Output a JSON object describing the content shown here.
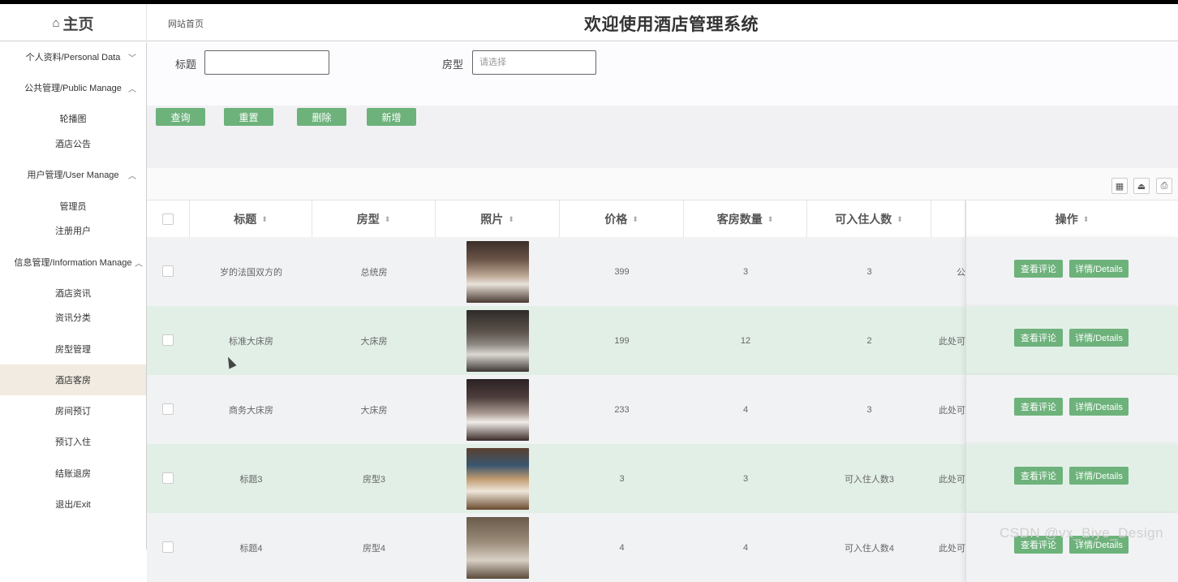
{
  "header": {
    "home_icon": "home-icon",
    "home_label": "主页",
    "breadcrumb": "网站首页",
    "title": "欢迎使用酒店管理系统"
  },
  "sidebar": {
    "groups": [
      {
        "label": "个人资料/Personal Data",
        "chevron": "﹀"
      },
      {
        "label": "公共管理/Public Manage",
        "chevron": "︿"
      },
      {
        "label": "用户管理/User Manage",
        "chevron": "︿"
      },
      {
        "label": "信息管理/Information Manage",
        "chevron": "︿"
      }
    ],
    "items": [
      "轮播图",
      "酒店公告",
      "管理员",
      "注册用户",
      "酒店资讯",
      "资讯分类",
      "房型管理",
      "酒店客房",
      "房间预订",
      "预订入住",
      "结账退房",
      "退出/Exit"
    ],
    "active": "酒店客房"
  },
  "search": {
    "title_label": "标题",
    "title_value": "",
    "type_label": "房型",
    "type_placeholder": "请选择"
  },
  "buttons": {
    "query": "查询",
    "reset": "重置",
    "delete": "删除",
    "add": "新增"
  },
  "toolbar": {
    "icons": [
      "grid-icon",
      "export-icon",
      "print-icon"
    ]
  },
  "table": {
    "headers": [
      "标题",
      "房型",
      "照片",
      "价格",
      "客房数量",
      "可入住人数",
      "",
      "操作"
    ],
    "sort_icon": "⬍",
    "rows": [
      {
        "title": "岁的法国双方的",
        "type": "总统房",
        "price": "399",
        "count": "3",
        "capacity": "3",
        "extra": "公"
      },
      {
        "title": "标准大床房",
        "type": "大床房",
        "price": "199",
        "count": "12",
        "capacity": "2",
        "extra": "此处可"
      },
      {
        "title": "商务大床房",
        "type": "大床房",
        "price": "233",
        "count": "4",
        "capacity": "3",
        "extra": "此处可"
      },
      {
        "title": "标题3",
        "type": "房型3",
        "price": "3",
        "count": "3",
        "capacity": "可入住人数3",
        "extra": "此处可"
      },
      {
        "title": "标题4",
        "type": "房型4",
        "price": "4",
        "count": "4",
        "capacity": "可入住人数4",
        "extra": "此处可"
      }
    ],
    "actions": {
      "comments": "查看评论",
      "details": "详情/Details"
    }
  },
  "colors": {
    "accent": "#6db27b",
    "active_menu": "#f1ebe1",
    "row_alt": "#e2efe7"
  },
  "watermark": "CSDN @vx_Biye_Design"
}
